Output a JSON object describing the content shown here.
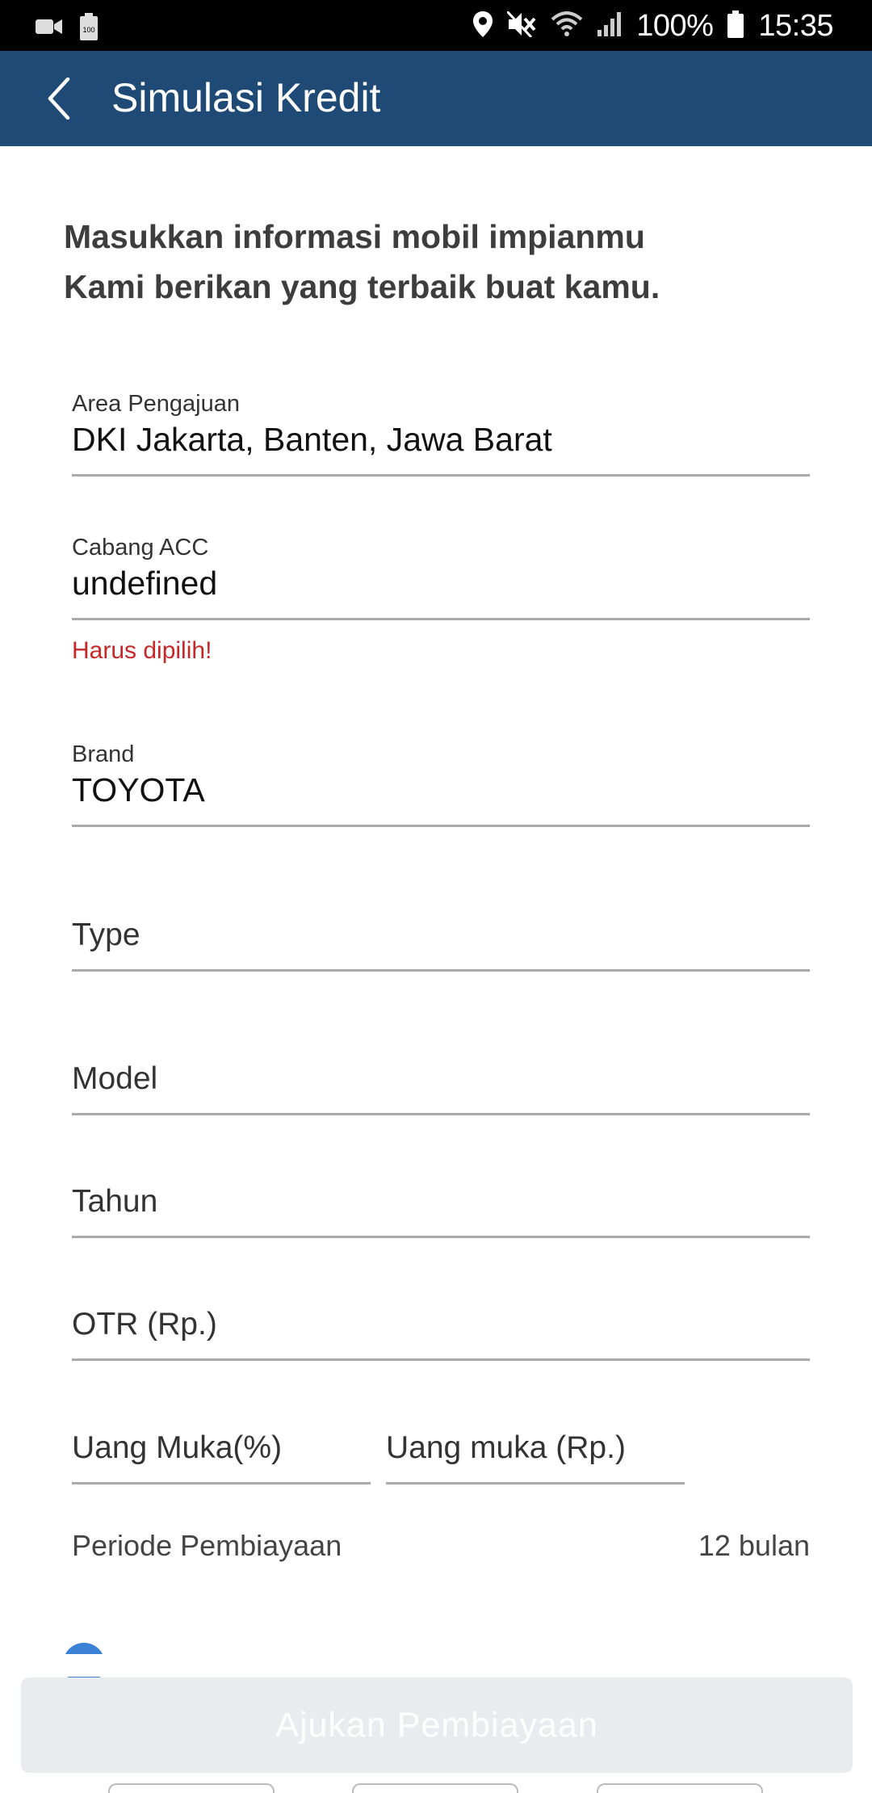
{
  "status_bar": {
    "battery_percent": "100%",
    "time": "15:35",
    "left_icons": [
      "video-icon",
      "battery-saver-icon"
    ],
    "right_icons": [
      "location-icon",
      "mute-icon",
      "wifi-icon",
      "signal-icon",
      "battery-icon"
    ]
  },
  "app_bar": {
    "title": "Simulasi Kredit",
    "background": "#1f4a75"
  },
  "intro": {
    "line1": "Masukkan informasi mobil impianmu",
    "line2": "Kami berikan yang terbaik buat kamu."
  },
  "form": {
    "area": {
      "label": "Area Pengajuan",
      "value": "DKI Jakarta, Banten, Jawa Barat"
    },
    "cabang": {
      "label": "Cabang ACC",
      "value": "undefined",
      "error": "Harus dipilih!"
    },
    "brand": {
      "label": "Brand",
      "value": "TOYOTA"
    },
    "type": {
      "placeholder": "Type"
    },
    "model": {
      "placeholder": "Model"
    },
    "tahun": {
      "placeholder": "Tahun"
    },
    "otr": {
      "placeholder": "OTR (Rp.)"
    },
    "dp_percent": {
      "placeholder": "Uang Muka(%)"
    },
    "dp_rp": {
      "placeholder": "Uang muka (Rp.)"
    },
    "period": {
      "label": "Periode Pembiayaan",
      "value": "12 bulan"
    }
  },
  "submit": {
    "label": "Ajukan Pembiayaan"
  },
  "colors": {
    "error": "#c62828",
    "accent_circle": "#3b82d6",
    "button_disabled_bg": "#e9ebee"
  }
}
